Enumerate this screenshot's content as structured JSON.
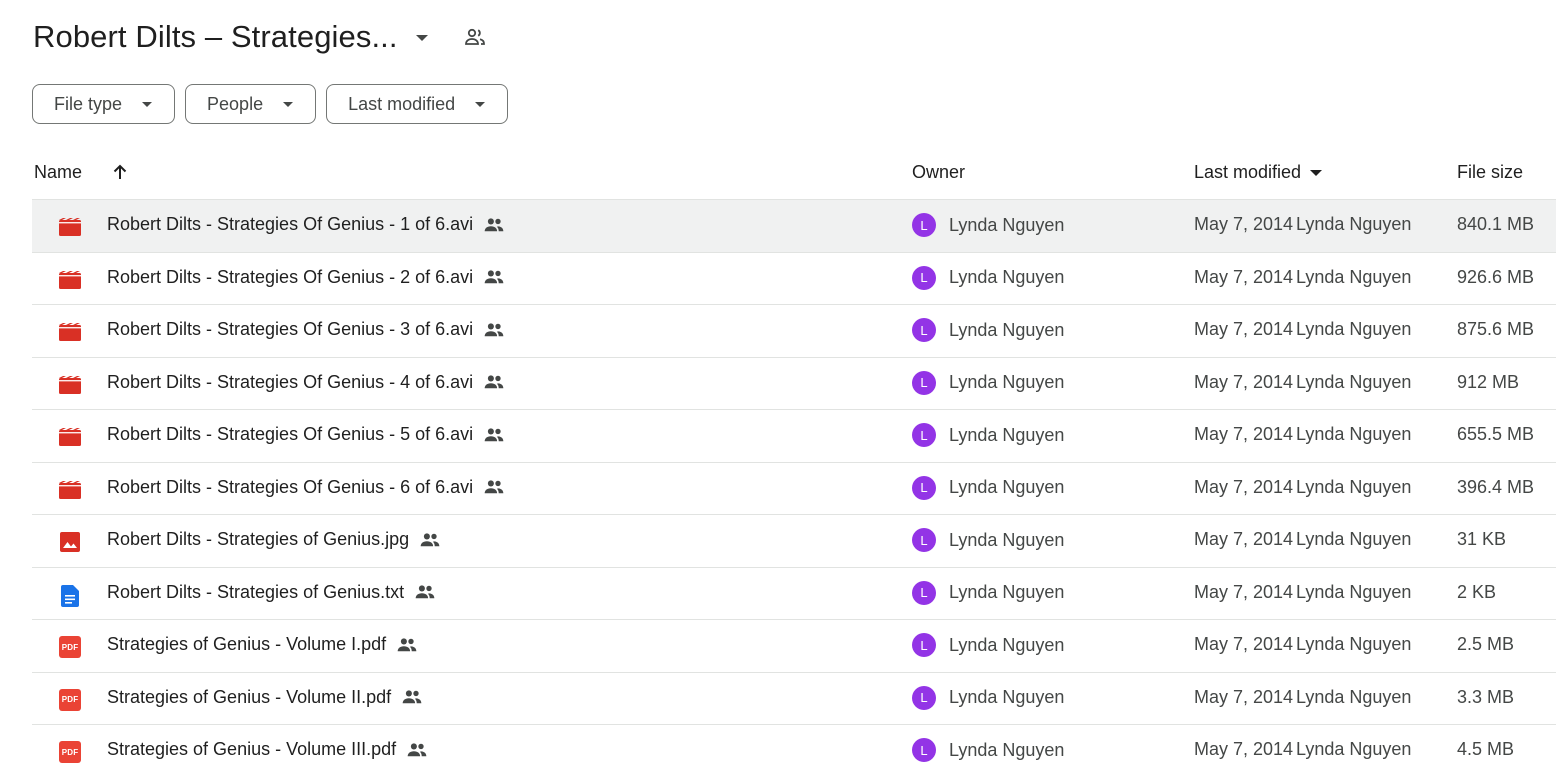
{
  "header": {
    "title": "Robert Dilts – Strategies..."
  },
  "filters": [
    {
      "label": "File type"
    },
    {
      "label": "People"
    },
    {
      "label": "Last modified"
    }
  ],
  "columns": {
    "name": "Name",
    "owner": "Owner",
    "last_modified": "Last modified",
    "file_size": "File size"
  },
  "files": [
    {
      "name": "Robert Dilts - Strategies Of Genius - 1 of 6.avi",
      "type": "video",
      "owner": "Lynda Nguyen",
      "owner_initial": "L",
      "modified_date": "May 7, 2014",
      "modified_by": "Lynda Nguyen",
      "size": "840.1 MB"
    },
    {
      "name": "Robert Dilts - Strategies Of Genius - 2 of 6.avi",
      "type": "video",
      "owner": "Lynda Nguyen",
      "owner_initial": "L",
      "modified_date": "May 7, 2014",
      "modified_by": "Lynda Nguyen",
      "size": "926.6 MB"
    },
    {
      "name": "Robert Dilts - Strategies Of Genius - 3 of 6.avi",
      "type": "video",
      "owner": "Lynda Nguyen",
      "owner_initial": "L",
      "modified_date": "May 7, 2014",
      "modified_by": "Lynda Nguyen",
      "size": "875.6 MB"
    },
    {
      "name": "Robert Dilts - Strategies Of Genius - 4 of 6.avi",
      "type": "video",
      "owner": "Lynda Nguyen",
      "owner_initial": "L",
      "modified_date": "May 7, 2014",
      "modified_by": "Lynda Nguyen",
      "size": "912 MB"
    },
    {
      "name": "Robert Dilts - Strategies Of Genius - 5 of 6.avi",
      "type": "video",
      "owner": "Lynda Nguyen",
      "owner_initial": "L",
      "modified_date": "May 7, 2014",
      "modified_by": "Lynda Nguyen",
      "size": "655.5 MB"
    },
    {
      "name": "Robert Dilts - Strategies Of Genius - 6 of 6.avi",
      "type": "video",
      "owner": "Lynda Nguyen",
      "owner_initial": "L",
      "modified_date": "May 7, 2014",
      "modified_by": "Lynda Nguyen",
      "size": "396.4 MB"
    },
    {
      "name": "Robert Dilts - Strategies of Genius.jpg",
      "type": "image",
      "owner": "Lynda Nguyen",
      "owner_initial": "L",
      "modified_date": "May 7, 2014",
      "modified_by": "Lynda Nguyen",
      "size": "31 KB"
    },
    {
      "name": "Robert Dilts - Strategies of Genius.txt",
      "type": "doc",
      "owner": "Lynda Nguyen",
      "owner_initial": "L",
      "modified_date": "May 7, 2014",
      "modified_by": "Lynda Nguyen",
      "size": "2 KB"
    },
    {
      "name": "Strategies of Genius - Volume I.pdf",
      "type": "pdf",
      "owner": "Lynda Nguyen",
      "owner_initial": "L",
      "modified_date": "May 7, 2014",
      "modified_by": "Lynda Nguyen",
      "size": "2.5 MB"
    },
    {
      "name": "Strategies of Genius - Volume II.pdf",
      "type": "pdf",
      "owner": "Lynda Nguyen",
      "owner_initial": "L",
      "modified_date": "May 7, 2014",
      "modified_by": "Lynda Nguyen",
      "size": "3.3 MB"
    },
    {
      "name": "Strategies of Genius - Volume III.pdf",
      "type": "pdf",
      "owner": "Lynda Nguyen",
      "owner_initial": "L",
      "modified_date": "May 7, 2014",
      "modified_by": "Lynda Nguyen",
      "size": "4.5 MB"
    }
  ],
  "icons": {
    "video": "video-file-icon",
    "image": "image-file-icon",
    "doc": "text-document-icon",
    "pdf": "pdf-file-icon",
    "shared": "shared-people-icon",
    "pdf_badge": "PDF"
  },
  "colors": {
    "avatar": "#9334e6",
    "video": "#d93025",
    "image": "#d93025",
    "doc": "#1a73e8",
    "pdf": "#ea4335",
    "selected_row": "#f0f1f1"
  }
}
